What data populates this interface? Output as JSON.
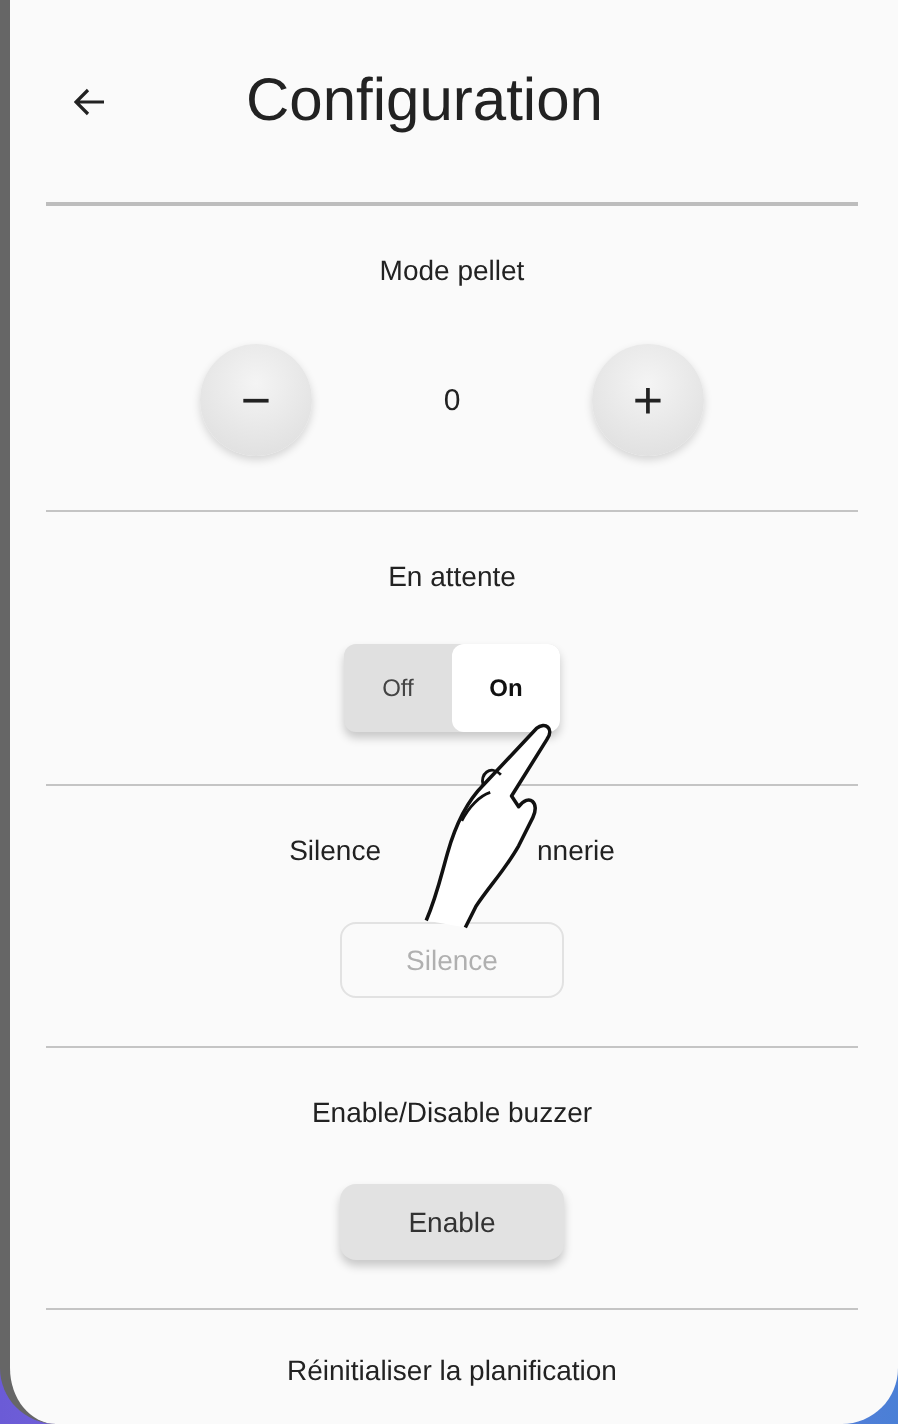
{
  "header": {
    "title": "Configuration"
  },
  "sections": [
    {
      "kind": "stepper",
      "title": [
        "Mode pellet"
      ],
      "value": "0",
      "minus": "−",
      "plus": "+"
    },
    {
      "kind": "toggle",
      "title": [
        "En attente"
      ],
      "options": [
        {
          "label": "Off",
          "selected": false
        },
        {
          "label": "On",
          "selected": true
        }
      ]
    },
    {
      "kind": "button",
      "title": [
        "Silence",
        "nnerie"
      ],
      "gesture": true,
      "button": {
        "label": "Silence",
        "disabled": true
      }
    },
    {
      "kind": "button",
      "title": [
        "Enable/Disable buzzer"
      ],
      "button": {
        "label": "Enable",
        "disabled": false
      }
    },
    {
      "kind": "heading",
      "title": [
        "Réinitialiser la planification"
      ]
    }
  ]
}
